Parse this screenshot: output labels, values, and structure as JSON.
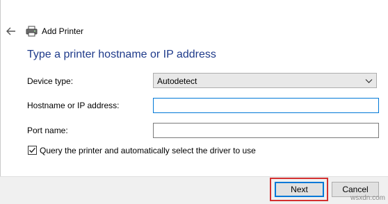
{
  "header": {
    "back_icon": "back-arrow-icon",
    "printer_icon": "printer-icon",
    "title": "Add Printer"
  },
  "page": {
    "heading": "Type a printer hostname or IP address"
  },
  "form": {
    "device_type": {
      "label": "Device type:",
      "value": "Autodetect"
    },
    "hostname": {
      "label": "Hostname or IP address:",
      "value": "",
      "focused": true
    },
    "port": {
      "label": "Port name:",
      "value": ""
    },
    "query_checkbox": {
      "checked": true,
      "label": "Query the printer and automatically select the driver to use"
    }
  },
  "footer": {
    "next_label": "Next",
    "cancel_label": "Cancel",
    "highlight_color": "#d32f2f",
    "accent_color": "#0078d7"
  },
  "watermark": "wsxdn.com"
}
